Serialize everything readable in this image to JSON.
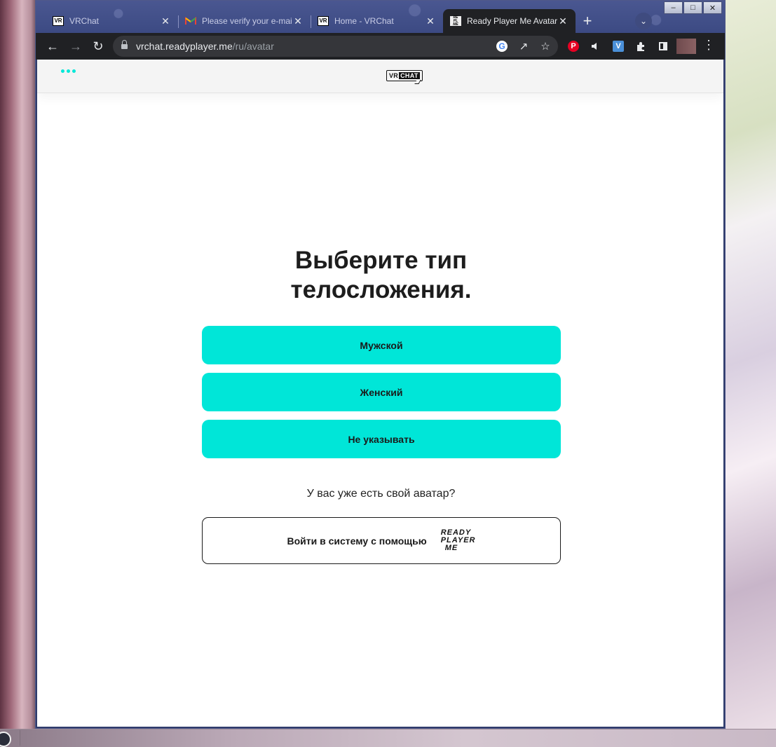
{
  "browser": {
    "tabs": [
      {
        "title": "VRChat",
        "favicon": "vrchat-favicon",
        "active": false
      },
      {
        "title": "Please verify your e-mail",
        "favicon": "gmail-favicon",
        "active": false
      },
      {
        "title": "Home - VRChat",
        "favicon": "vrchat-favicon",
        "active": false
      },
      {
        "title": "Ready Player Me Avatar",
        "favicon": "readyplayerme-favicon",
        "active": true
      }
    ],
    "new_tab_icon": "+",
    "url_host": "vrchat.readyplayer.me",
    "url_path": "/ru/avatar",
    "window_controls": [
      "minimize",
      "maximize",
      "close"
    ]
  },
  "site": {
    "logo_vr": "VR",
    "logo_chat": "CHAT"
  },
  "page": {
    "heading_line1": "Выберите тип",
    "heading_line2": "телосложения.",
    "options": [
      {
        "label": "Мужской"
      },
      {
        "label": "Женский"
      },
      {
        "label": "Не указывать"
      }
    ],
    "question": "У вас уже есть свой аватар?",
    "signin_label": "Войти в систему с помощью",
    "rpm_logo_lines": [
      "READY",
      "PLAYER",
      "ME"
    ]
  },
  "colors": {
    "accent": "#00e6d8",
    "tab_strip": "#3c4a83",
    "toolbar": "#202124"
  }
}
